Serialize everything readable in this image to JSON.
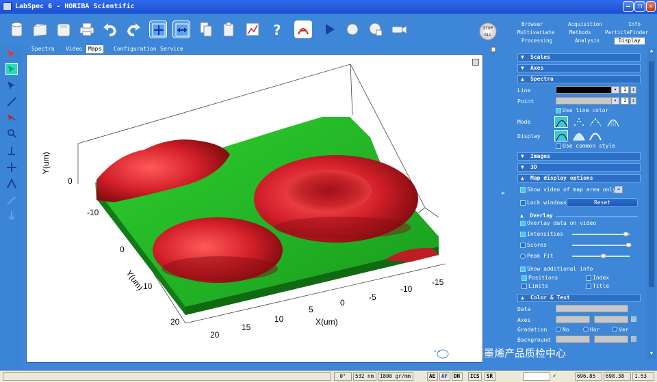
{
  "window": {
    "title": "LabSpec 6 - HORIBA Scientific"
  },
  "toolbar": {
    "icons": [
      "new-icon",
      "open-icon",
      "save-icon",
      "print-icon",
      "undo-icon",
      "redo-icon",
      "crosshair-icon",
      "split-icon",
      "copy-icon",
      "paste-icon",
      "chart-edit-icon",
      "help-icon",
      "pdf-icon",
      "play-icon",
      "stop-record-icon",
      "grid-icon",
      "camera-icon"
    ],
    "stop_all_label": "STOP ALL"
  },
  "main_tabs": [
    "Spectra",
    "Video",
    "Maps",
    "Configuration",
    "Service"
  ],
  "selected_main_tab": "Maps",
  "plot": {
    "x_axis_label": "X(um)",
    "y_axis_label_front": "Y(um)",
    "y_axis_label_side": "Y(um)",
    "x_ticks": [
      "20",
      "15",
      "10",
      "5",
      "0",
      "-5",
      "-10",
      "-15"
    ],
    "y_ticks_front": [
      "20",
      "10",
      "0",
      "-10"
    ],
    "y_ticks_side": [
      "0"
    ]
  },
  "right_tabs": {
    "row1": [
      "Browser",
      "Acquisition",
      "Info"
    ],
    "row2": [
      "Multivariate",
      "Methods",
      "ParticleFinder"
    ],
    "row3": [
      "Processing",
      "Analysis",
      "Display"
    ],
    "selected": "Display"
  },
  "panel": {
    "scales": "Scales",
    "axes": "Axes",
    "spectra": "Spectra",
    "line_label": "Line",
    "line_width": "1",
    "point_label": "Point",
    "point_width": "1",
    "use_line_color": "Use line color",
    "mode_label": "Mode",
    "display_label": "Display",
    "use_common_style": "Use common style",
    "images": "Images",
    "threed": "3D",
    "map_display_options": "Map display options",
    "show_video_of_map_area": "Show video of map area only",
    "lock_windows": "Lock windows",
    "reset": "Reset",
    "overlay": "Overlay",
    "overlay_data_on_video": "Overlay data on video",
    "intensities": "Intensities",
    "scores": "Scores",
    "peak_fit": "Peak Fit",
    "show_additional_info": "Show additional info",
    "positions": "Positions",
    "index": "Index",
    "limits": "Limits",
    "title": "Title",
    "color_text": "Color & Text",
    "data": "Data",
    "axes_row": "Axes",
    "gradation": "Gradation",
    "gradation_no": "No",
    "gradation_hor": "Hor",
    "gradation_ver": "Ver",
    "background": "Background"
  },
  "status": {
    "angle": "0°",
    "wavelength": "532 nm",
    "grating": "1800 gr/mm",
    "toggles": [
      "AE",
      "AF",
      "DN",
      "ICS",
      "SR"
    ],
    "field1": "",
    "check": "✔",
    "coord_x": "696.85",
    "coord_y": "698.38",
    "zoom": "1.53"
  },
  "watermark": "国家石墨烯产品质检中心",
  "colors": {
    "surface_red": "#d4202a",
    "surface_green": "#22b527",
    "panel_blue": "#3d86d8",
    "title_blue": "#1a4fd0"
  }
}
